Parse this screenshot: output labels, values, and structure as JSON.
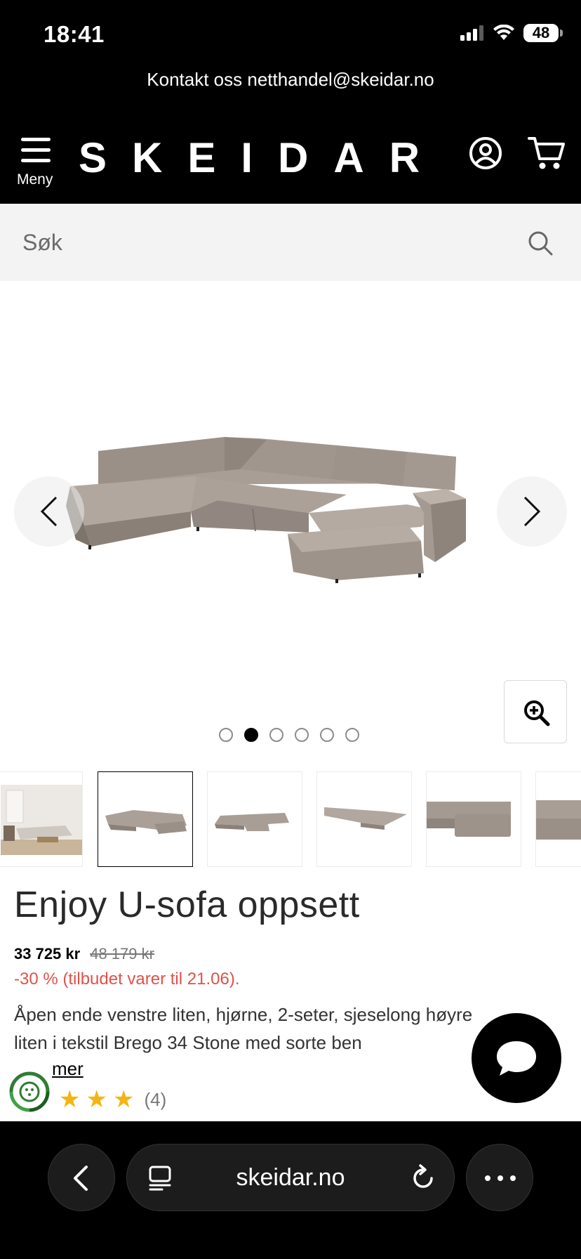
{
  "status_bar": {
    "time": "18:41",
    "battery": "48"
  },
  "contact": {
    "text": "Kontakt oss netthandel@skeidar.no"
  },
  "header": {
    "menu_label": "Meny",
    "logo": "SKEIDAR"
  },
  "search": {
    "placeholder": "Søk"
  },
  "gallery": {
    "slide_count": 6,
    "active_slide": 2,
    "thumbnail_count": 6,
    "active_thumbnail": 2
  },
  "product": {
    "title": "Enjoy U-sofa oppsett",
    "price_now": "33 725 kr",
    "price_old": "48 179 kr",
    "discount": "-30 % (tilbudet varer til 21.06).",
    "description_line1": "Åpen ende venstre liten, hjørne, 2-seter, sjeselong høyre",
    "description_line2": "liten i tekstil Brego 34 Stone med sorte ben",
    "read_more": "mer",
    "review_count": "(4)"
  },
  "browser": {
    "url": "skeidar.no"
  },
  "colors": {
    "header_bg": "#000000",
    "search_bg": "#f3f3f3",
    "discount_red": "#e0524a",
    "star_yellow": "#f3b511",
    "sofa": "#9d938b"
  },
  "icons": [
    "hamburger-icon",
    "account-icon",
    "cart-icon",
    "search-icon",
    "chevron-left-icon",
    "chevron-right-icon",
    "zoom-in-icon",
    "chat-icon",
    "back-icon",
    "tabs-icon",
    "reload-icon",
    "more-icon",
    "eco-badge-icon",
    "star-icon"
  ]
}
